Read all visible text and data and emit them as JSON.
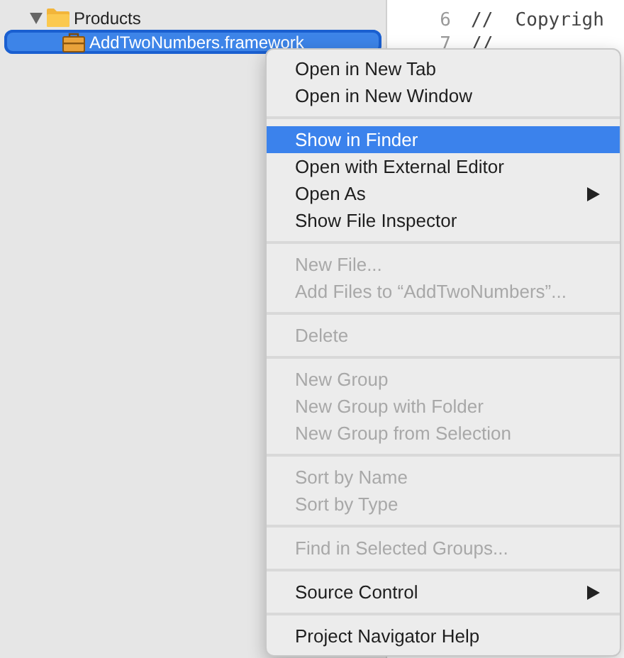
{
  "navigator": {
    "items": [
      {
        "label": "Products",
        "kind": "folder",
        "expanded": true,
        "selected": false,
        "children": [
          {
            "label": "AddTwoNumbers.framework",
            "kind": "framework",
            "selected": true
          }
        ]
      }
    ]
  },
  "editor": {
    "lines": [
      {
        "number": "6",
        "code": "//  Copyrigh"
      },
      {
        "number": "7",
        "code": "//"
      }
    ]
  },
  "context_menu": {
    "sections": [
      [
        {
          "label": "Open in New Tab",
          "disabled": false,
          "selected": false,
          "submenu": false
        },
        {
          "label": "Open in New Window",
          "disabled": false,
          "selected": false,
          "submenu": false
        }
      ],
      [
        {
          "label": "Show in Finder",
          "disabled": false,
          "selected": true,
          "submenu": false
        },
        {
          "label": "Open with External Editor",
          "disabled": false,
          "selected": false,
          "submenu": false
        },
        {
          "label": "Open As",
          "disabled": false,
          "selected": false,
          "submenu": true
        },
        {
          "label": "Show File Inspector",
          "disabled": false,
          "selected": false,
          "submenu": false
        }
      ],
      [
        {
          "label": "New File...",
          "disabled": true,
          "selected": false,
          "submenu": false
        },
        {
          "label": "Add Files to “AddTwoNumbers”...",
          "disabled": true,
          "selected": false,
          "submenu": false
        }
      ],
      [
        {
          "label": "Delete",
          "disabled": true,
          "selected": false,
          "submenu": false
        }
      ],
      [
        {
          "label": "New Group",
          "disabled": true,
          "selected": false,
          "submenu": false
        },
        {
          "label": "New Group with Folder",
          "disabled": true,
          "selected": false,
          "submenu": false
        },
        {
          "label": "New Group from Selection",
          "disabled": true,
          "selected": false,
          "submenu": false
        }
      ],
      [
        {
          "label": "Sort by Name",
          "disabled": true,
          "selected": false,
          "submenu": false
        },
        {
          "label": "Sort by Type",
          "disabled": true,
          "selected": false,
          "submenu": false
        }
      ],
      [
        {
          "label": "Find in Selected Groups...",
          "disabled": true,
          "selected": false,
          "submenu": false
        }
      ],
      [
        {
          "label": "Source Control",
          "disabled": false,
          "selected": false,
          "submenu": true
        }
      ],
      [
        {
          "label": "Project Navigator Help",
          "disabled": false,
          "selected": false,
          "submenu": false
        }
      ]
    ]
  }
}
